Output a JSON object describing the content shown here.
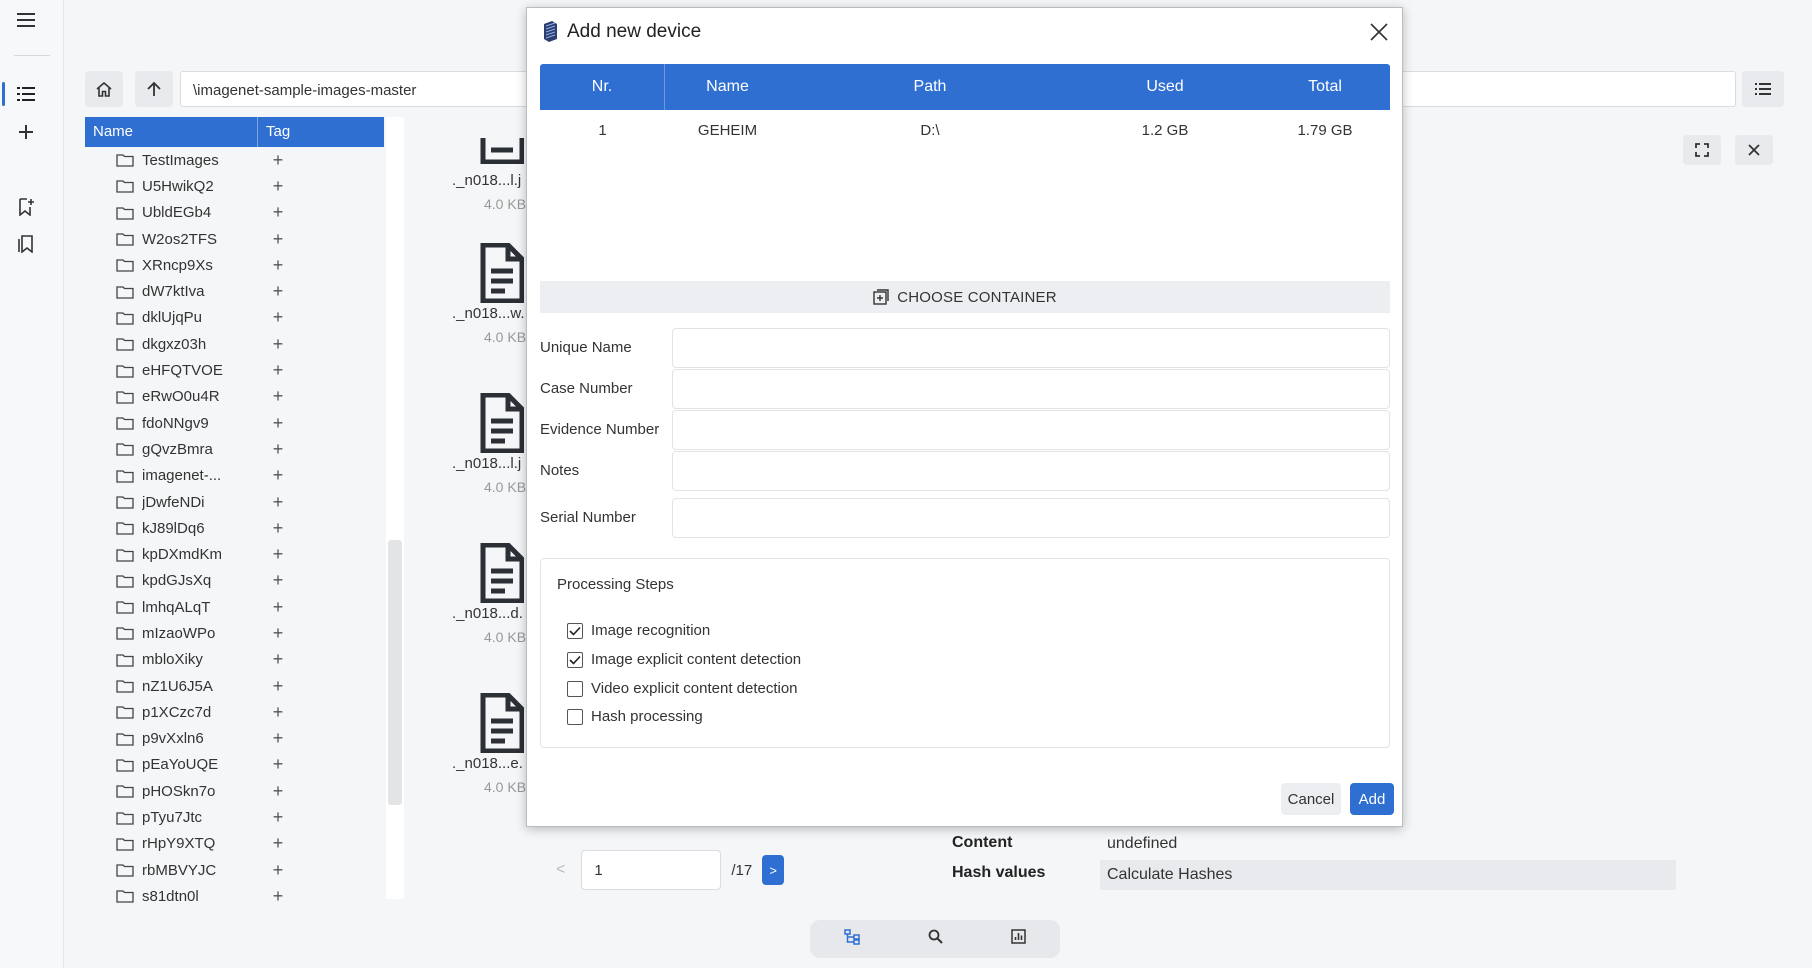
{
  "path": {
    "value": "\\imagenet-sample-images-master"
  },
  "tree": {
    "headers": {
      "name": "Name",
      "tag": "Tag"
    },
    "items": [
      "TestImages",
      "U5HwikQ2",
      "UbldEGb4",
      "W2os2TFS",
      "XRncp9Xs",
      "dW7ktIva",
      "dklUjqPu",
      "dkgxz03h",
      "eHFQTVOE",
      "eRwO0u4R",
      "fdoNNgv9",
      "gQvzBmra",
      "imagenet-...",
      "jDwfeNDi",
      "kJ89lDq6",
      "kpDXmdKm",
      "kpdGJsXq",
      "lmhqALqT",
      "mIzaoWPo",
      "mbloXiky",
      "nZ1U6J5A",
      "p1XCzc7d",
      "p9vXxln6",
      "pEaYoUQE",
      "pHOSkn7o",
      "pTyu7Jtc",
      "rHpY9XTQ",
      "rbMBVYJC",
      "s81dtn0l"
    ],
    "add_symbol": "+"
  },
  "thumbnails": [
    {
      "caption": "._n018...l.j",
      "size": "4.0 KB"
    },
    {
      "caption": "._n018...w.",
      "size": "4.0 KB"
    },
    {
      "caption": "._n018...l.j",
      "size": "4.0 KB"
    },
    {
      "caption": "._n018...d.",
      "size": "4.0 KB"
    },
    {
      "caption": "._n018...e.",
      "size": "4.0 KB"
    }
  ],
  "pager": {
    "prev": "<",
    "page": "1",
    "of": "/17",
    "next": ">"
  },
  "properties": {
    "content_label": "Content",
    "content_value": "undefined",
    "hash_label": "Hash values",
    "hash_value": "Calculate Hashes"
  },
  "modal": {
    "title": "Add new device",
    "table": {
      "headers": [
        "Nr.",
        "Name",
        "Path",
        "Used",
        "Total"
      ],
      "rows": [
        [
          "1",
          "GEHEIM",
          "D:\\",
          "1.2 GB",
          "1.79 GB"
        ]
      ]
    },
    "choose_container": "CHOOSE CONTAINER",
    "fields": [
      {
        "label": "Unique Name",
        "value": ""
      },
      {
        "label": "Case Number",
        "value": ""
      },
      {
        "label": "Evidence Number",
        "value": ""
      },
      {
        "label": "Notes",
        "value": ""
      },
      {
        "label": "Serial Number",
        "value": ""
      }
    ],
    "processing": {
      "title": "Processing Steps",
      "steps": [
        {
          "label": "Image recognition",
          "checked": true
        },
        {
          "label": "Image explicit content detection",
          "checked": true
        },
        {
          "label": "Video explicit content detection",
          "checked": false
        },
        {
          "label": "Hash processing",
          "checked": false
        }
      ]
    },
    "cancel_label": "Cancel",
    "add_label": "Add"
  },
  "colors": {
    "accent": "#2f6fd1",
    "background": "#f5f6f8"
  },
  "icons": [
    "hamburger-icon",
    "list-icon",
    "plus-icon",
    "bookmark-add-icon",
    "bookmarks-icon",
    "home-icon",
    "arrow-up-icon",
    "folder-icon",
    "document-icon",
    "fullscreen-icon",
    "close-icon",
    "tree-icon",
    "search-icon",
    "chart-icon",
    "app-logo-icon",
    "container-add-icon",
    "checkbox-checked-icon"
  ]
}
